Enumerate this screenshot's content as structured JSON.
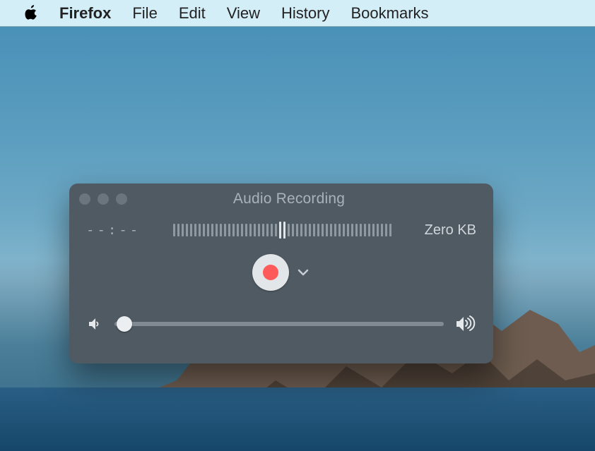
{
  "menubar": {
    "app_name": "Firefox",
    "items": [
      "File",
      "Edit",
      "View",
      "History",
      "Bookmarks"
    ]
  },
  "window": {
    "title": "Audio Recording",
    "time_display": "--:--",
    "file_size": "Zero KB",
    "volume_percent": 3
  }
}
